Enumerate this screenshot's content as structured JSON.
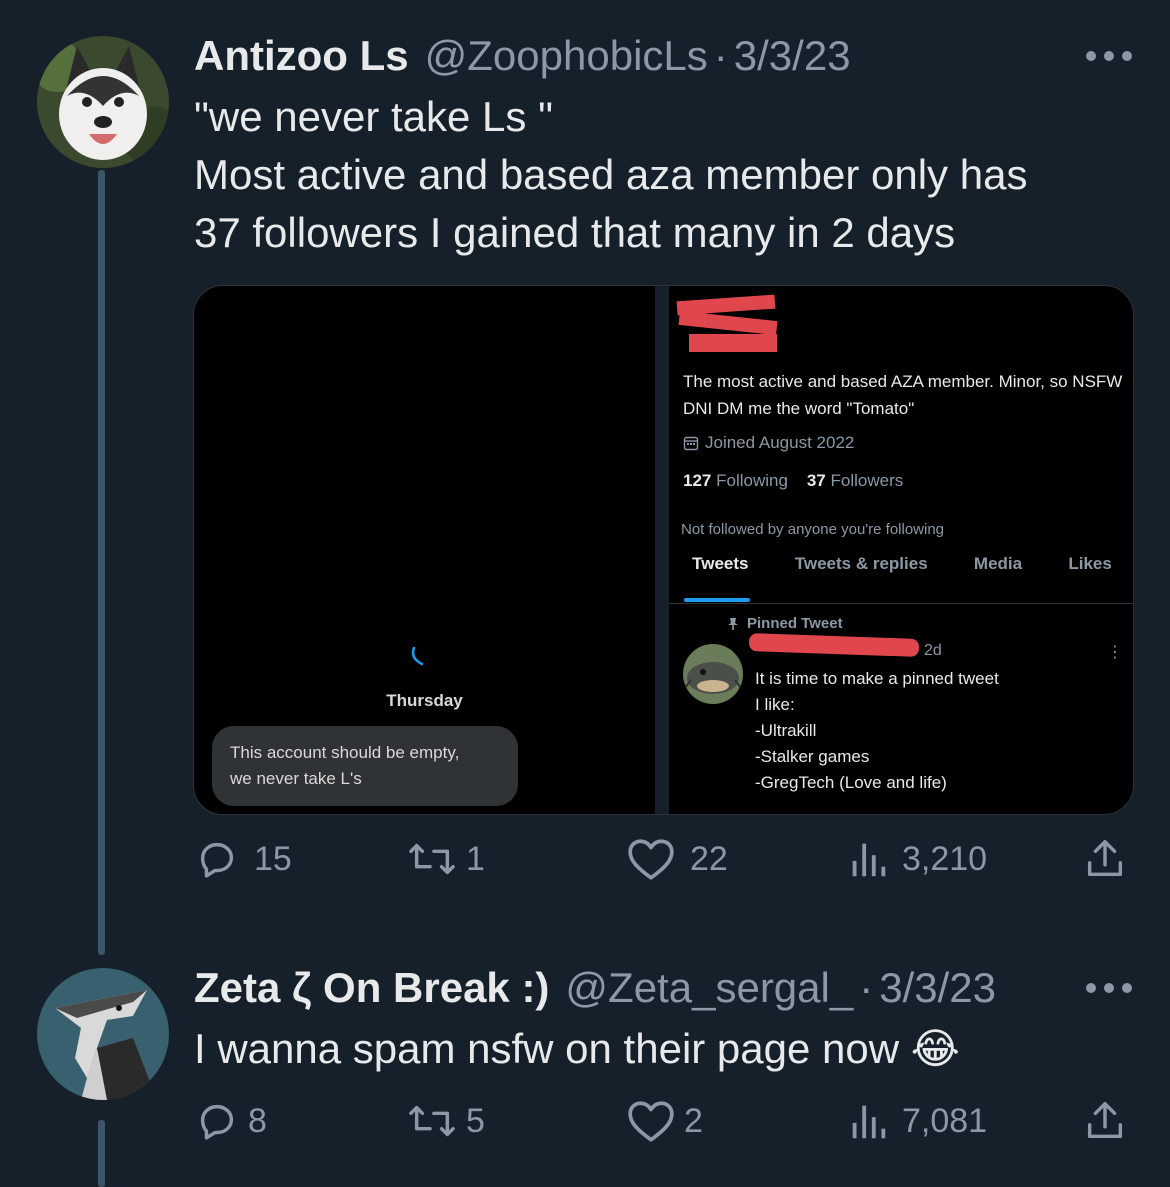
{
  "tweet1": {
    "display_name": "Antizoo Ls",
    "handle": "@ZoophobicLs",
    "separator": "·",
    "date": "3/3/23",
    "text": "\"we never take Ls \"\nMost active and based aza member only has\n37 followers I gained that many in 2 days",
    "media": {
      "left": {
        "day_label": "Thursday",
        "dm_text": "This account should be empty,\nwe never take L's"
      },
      "right": {
        "bio": "The most active and based AZA member.  Minor, so NSFW DNI  DM me the word \"Tomato\"",
        "joined": "Joined August 2022",
        "following_count": "127",
        "following_label": "Following",
        "followers_count": "37",
        "followers_label": "Followers",
        "not_followed": "Not followed by anyone you're following",
        "tabs": [
          "Tweets",
          "Tweets & replies",
          "Media",
          "Likes"
        ],
        "pinned_label": "Pinned Tweet",
        "pinned_date": "2d",
        "pinned_more": "⋮",
        "pinned_text": "It is time to make a pinned tweet\nI like:\n-Ultrakill\n-Stalker games\n-GregTech (Love and life)"
      }
    },
    "stats": {
      "replies": "15",
      "retweets": "1",
      "likes": "22",
      "views": "3,210"
    }
  },
  "tweet2": {
    "display_name": "Zeta ζ On Break :)",
    "handle": "@Zeta_sergal_",
    "separator": "·",
    "date": "3/3/23",
    "text": "I wanna spam nsfw on their page now 😂",
    "stats": {
      "replies": "8",
      "retweets": "5",
      "likes": "2",
      "views": "7,081"
    }
  },
  "colors": {
    "background": "#15202b",
    "text_primary": "#e7e9ea",
    "text_secondary": "#8b98a5",
    "thread_line": "#3d5466",
    "redaction": "#e0474c",
    "accent": "#1d9bf0"
  },
  "icons": [
    "more-icon",
    "reply-icon",
    "retweet-icon",
    "like-icon",
    "views-icon",
    "share-icon",
    "calendar-icon",
    "pin-icon",
    "spinner-icon"
  ]
}
